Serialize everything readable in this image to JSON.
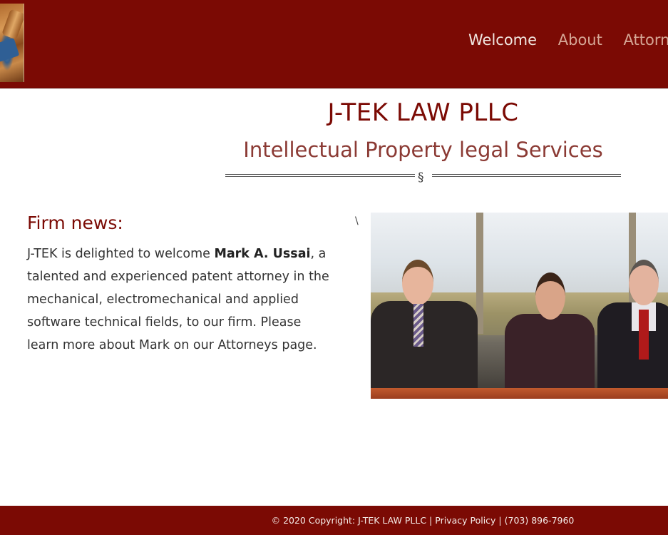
{
  "header": {
    "logo_icon": "stamp-logo-icon",
    "nav": [
      {
        "label": "Welcome",
        "active": true
      },
      {
        "label": "About",
        "active": false
      },
      {
        "label": "Attorne",
        "active": false
      }
    ]
  },
  "hero": {
    "title": "J-TEK LAW PLLC",
    "subtitle": "Intellectual Property legal Services",
    "divider_symbol": "§"
  },
  "news": {
    "heading": "Firm news:",
    "body_pre": "J-TEK is delighted to welcome ",
    "body_bold": "Mark A. Ussai",
    "body_post": ", a talented and experienced patent attorney in the mechanical, electromechanical and applied software technical fields, to our firm. Please learn more about Mark on our Attorneys page.",
    "stray_char": "\\"
  },
  "photo": {
    "subject": "team-photo"
  },
  "footer": {
    "copyright": "© 2020 Copyright: J-TEK LAW PLLC",
    "sep1": " | ",
    "privacy": "Privacy Policy",
    "sep2": " | ",
    "phone": "(703) 896-7960"
  },
  "colors": {
    "brand": "#7b0a04",
    "nav_active": "#f1e6e0",
    "nav_inactive": "#d6a796"
  }
}
